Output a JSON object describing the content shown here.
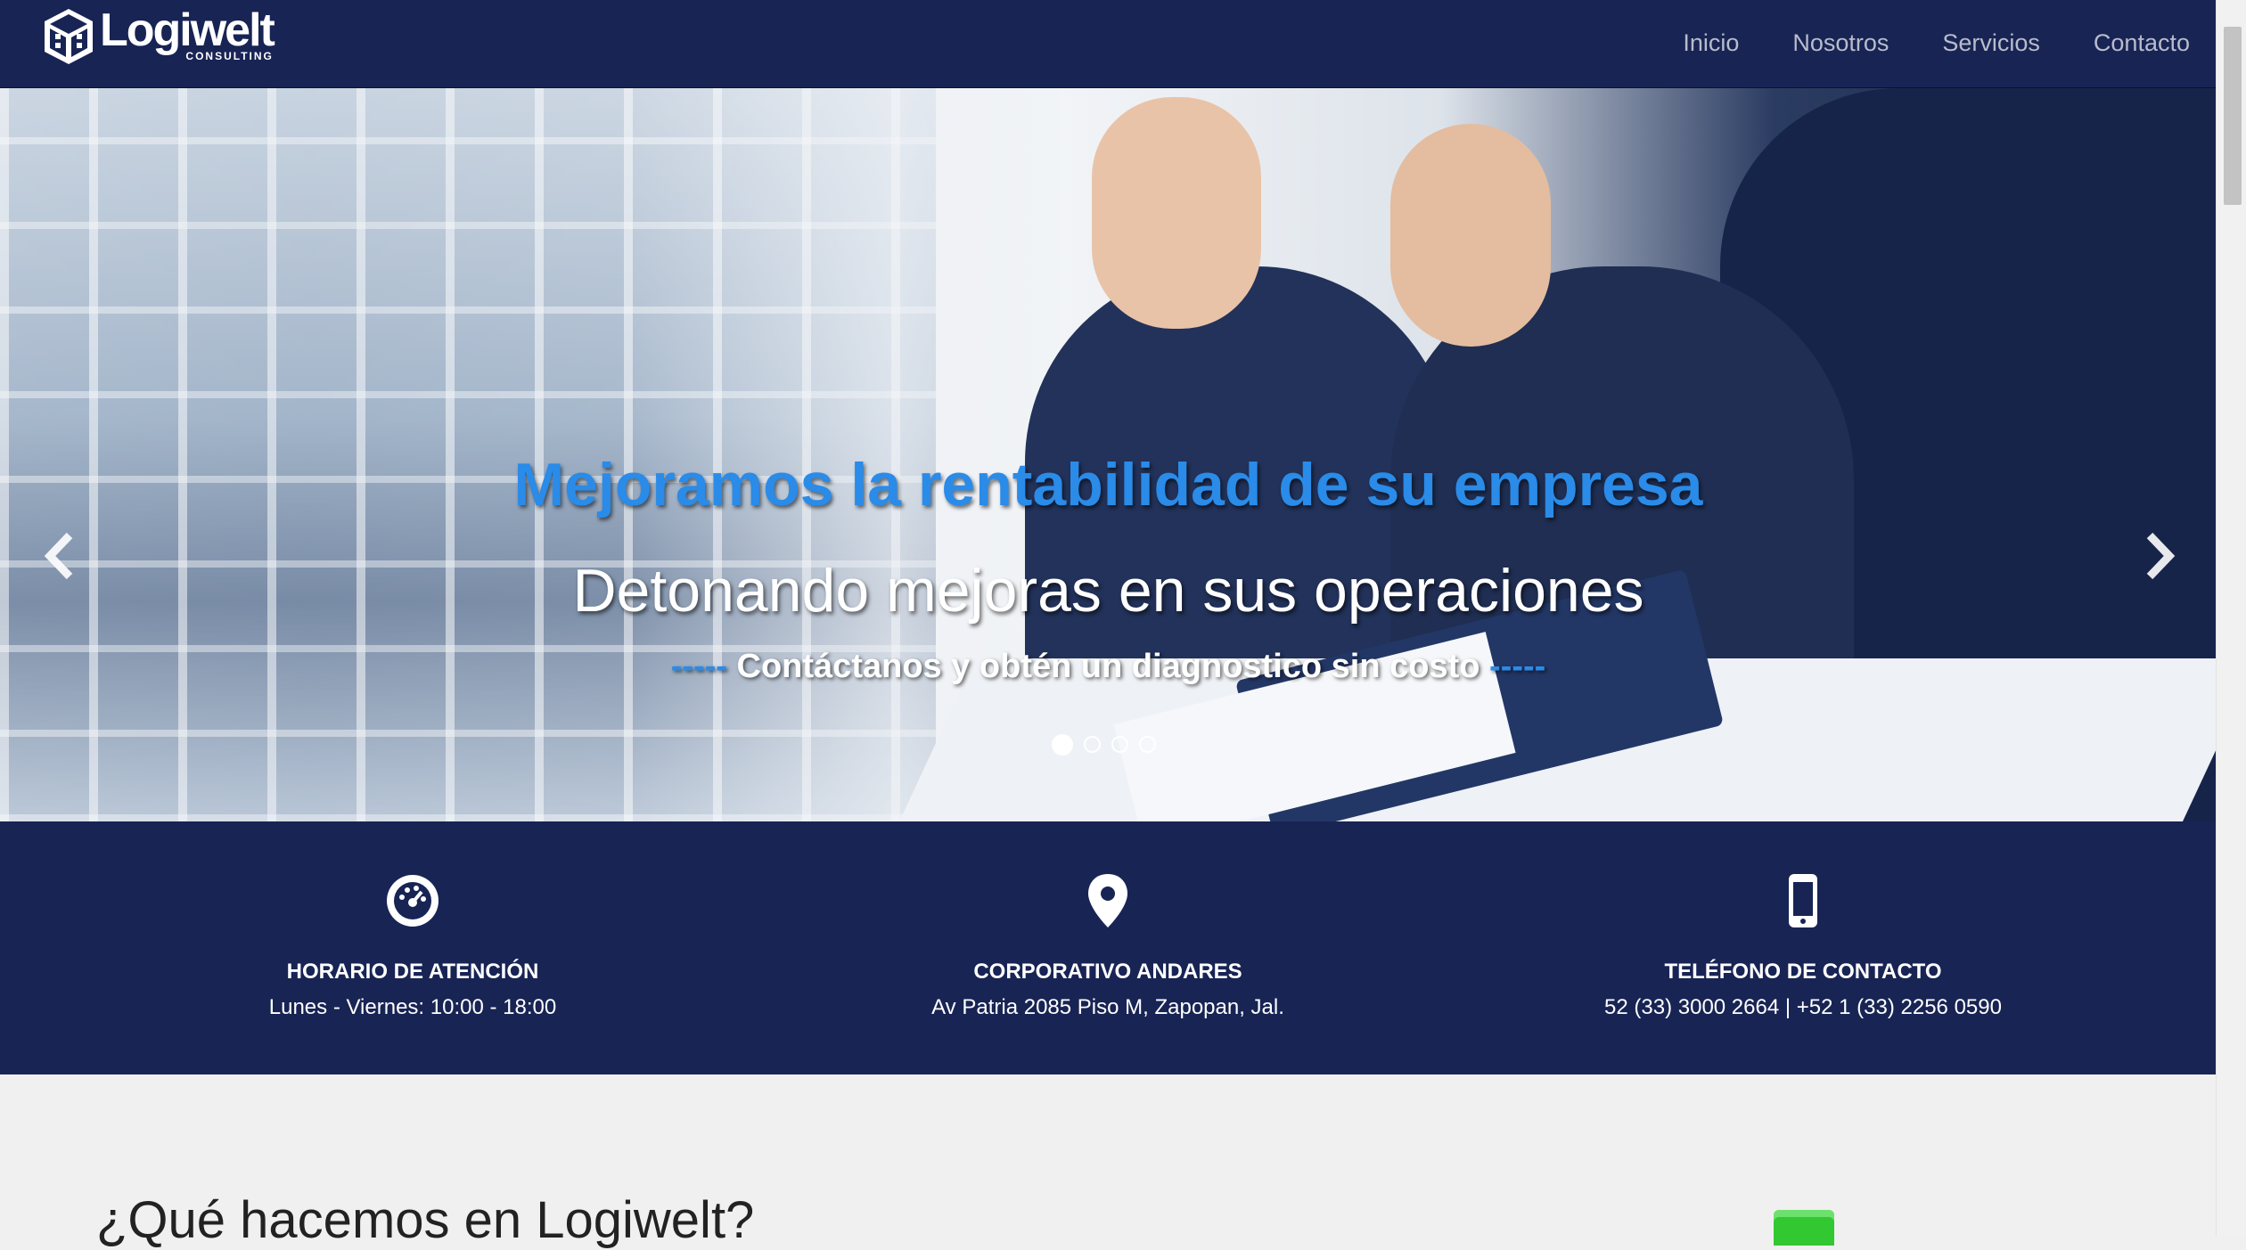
{
  "navbar": {
    "brand_name": "Logiwelt",
    "brand_sub": "CONSULTING",
    "links": [
      "Inicio",
      "Nosotros",
      "Servicios",
      "Contacto"
    ]
  },
  "hero": {
    "title": "Mejoramos la rentabilidad de su empresa",
    "subtitle": "Detonando mejoras en sus operaciones",
    "cta_dash_left": "-----",
    "cta_text": " Contáctanos y obtén un diagnostico sin costo ",
    "cta_dash_right": "-----",
    "slides_total": 4,
    "active_slide": 1
  },
  "info": {
    "hours": {
      "title": "HORARIO DE ATENCIÓN",
      "value": "Lunes - Viernes: 10:00 - 18:00",
      "icon": "dashboard-icon"
    },
    "office": {
      "title": "CORPORATIVO ANDARES",
      "value": "Av Patria 2085 Piso M, Zapopan, Jal.",
      "icon": "map-pin-icon"
    },
    "phone": {
      "title": "TELÉFONO DE CONTACTO",
      "value": "52 (33) 3000 2664 | +52 1 (33) 2256 0590",
      "icon": "mobile-phone-icon"
    }
  },
  "section": {
    "heading": "¿Qué hacemos en Logiwelt?"
  },
  "colors": {
    "navy": "#182454",
    "accent_blue": "#2a8be8",
    "background": "#f0f0f0"
  }
}
